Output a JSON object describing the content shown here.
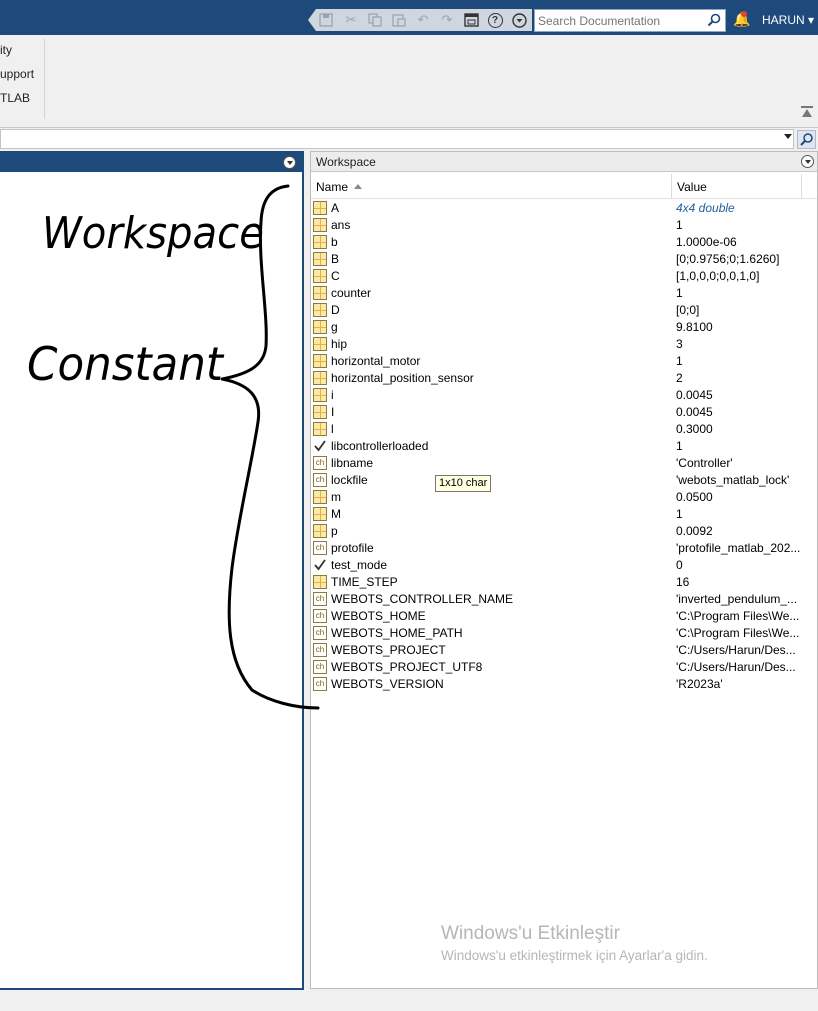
{
  "toolbar": {
    "search_placeholder": "Search Documentation",
    "user_label": "HARUN ▾",
    "icons": [
      "save-icon",
      "cut-icon",
      "copy-icon",
      "paste-icon",
      "undo-icon",
      "redo-icon",
      "switch-windows-icon",
      "help-icon",
      "options-icon"
    ],
    "accent_color": "#1d4a7a"
  },
  "ribbon": {
    "items": [
      "ity",
      "upport",
      "TLAB"
    ]
  },
  "workspace": {
    "title": "Workspace",
    "col_name": "Name",
    "col_value": "Value",
    "tooltip": "1x10 char",
    "rows": [
      {
        "icon": "matrix-icon",
        "name": "A",
        "value": "4x4 double",
        "style": "link"
      },
      {
        "icon": "matrix-icon",
        "name": "ans",
        "value": "1"
      },
      {
        "icon": "matrix-icon",
        "name": "b",
        "value": "1.0000e-06"
      },
      {
        "icon": "matrix-icon",
        "name": "B",
        "value": "[0;0.9756;0;1.6260]"
      },
      {
        "icon": "matrix-icon",
        "name": "C",
        "value": "[1,0,0,0;0,0,1,0]"
      },
      {
        "icon": "matrix-icon",
        "name": "counter",
        "value": "1"
      },
      {
        "icon": "matrix-icon",
        "name": "D",
        "value": "[0;0]"
      },
      {
        "icon": "matrix-icon",
        "name": "g",
        "value": "9.8100"
      },
      {
        "icon": "matrix-icon",
        "name": "hip",
        "value": "3"
      },
      {
        "icon": "matrix-icon",
        "name": "horizontal_motor",
        "value": "1"
      },
      {
        "icon": "matrix-icon",
        "name": "horizontal_position_sensor",
        "value": "2"
      },
      {
        "icon": "matrix-icon",
        "name": "i",
        "value": "0.0045"
      },
      {
        "icon": "matrix-icon",
        "name": "I",
        "value": "0.0045"
      },
      {
        "icon": "matrix-icon",
        "name": "l",
        "value": "0.3000"
      },
      {
        "icon": "logical-icon",
        "name": "libcontrollerloaded",
        "value": "1"
      },
      {
        "icon": "char-icon",
        "name": "libname",
        "value": "'Controller'"
      },
      {
        "icon": "char-icon",
        "name": "lockfile",
        "value": "'webots_matlab_lock'"
      },
      {
        "icon": "matrix-icon",
        "name": "m",
        "value": "0.0500"
      },
      {
        "icon": "matrix-icon",
        "name": "M",
        "value": "1"
      },
      {
        "icon": "matrix-icon",
        "name": "p",
        "value": "0.0092"
      },
      {
        "icon": "char-icon",
        "name": "protofile",
        "value": "'protofile_matlab_202..."
      },
      {
        "icon": "logical-icon",
        "name": "test_mode",
        "value": "0"
      },
      {
        "icon": "matrix-icon",
        "name": "TIME_STEP",
        "value": "16"
      },
      {
        "icon": "char-icon",
        "name": "WEBOTS_CONTROLLER_NAME",
        "value": "'inverted_pendulum_..."
      },
      {
        "icon": "char-icon",
        "name": "WEBOTS_HOME",
        "value": "'C:\\Program Files\\We..."
      },
      {
        "icon": "char-icon",
        "name": "WEBOTS_HOME_PATH",
        "value": "'C:\\Program Files\\We..."
      },
      {
        "icon": "char-icon",
        "name": "WEBOTS_PROJECT",
        "value": "'C:/Users/Harun/Des..."
      },
      {
        "icon": "char-icon",
        "name": "WEBOTS_PROJECT_UTF8",
        "value": "'C:/Users/Harun/Des..."
      },
      {
        "icon": "char-icon",
        "name": "WEBOTS_VERSION",
        "value": "'R2023a'"
      }
    ]
  },
  "handwriting": {
    "word1": "Workspace",
    "word2": "Constant"
  },
  "watermark": {
    "line1": "Windows'u Etkinleştir",
    "line2": "Windows'u etkinleştirmek için Ayarlar'a gidin."
  }
}
